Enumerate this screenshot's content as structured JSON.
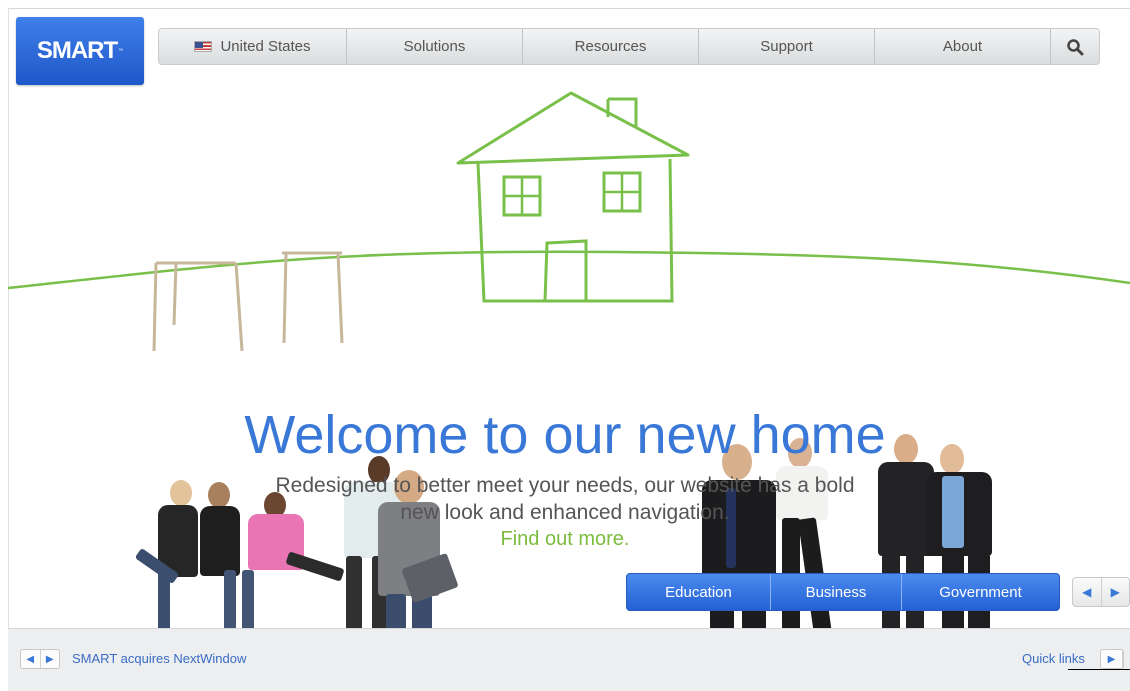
{
  "brand": {
    "logo_text": "SMART",
    "logo_tm": "™",
    "logo_color": "#2a66d6"
  },
  "nav": {
    "items": [
      {
        "label": "United States",
        "icon": "us-flag-icon"
      },
      {
        "label": "Solutions"
      },
      {
        "label": "Resources"
      },
      {
        "label": "Support"
      },
      {
        "label": "About"
      }
    ],
    "search_icon": "search-icon"
  },
  "hero": {
    "headline": "Welcome to our new home",
    "subline_1": "Redesigned to better meet your needs, our website has a bold",
    "subline_2": "new look and enhanced navigation.",
    "cta": "Find out more.",
    "headline_color": "#3a78d8",
    "cta_color": "#7cbc3c",
    "illustration_color": "#79c04a"
  },
  "segments": [
    "Education",
    "Business",
    "Government"
  ],
  "carousel": {
    "prev_icon": "left-arrow-icon",
    "next_icon": "right-arrow-icon"
  },
  "footer": {
    "news_text": "SMART acquires NextWindow",
    "quick_links": "Quick links"
  }
}
